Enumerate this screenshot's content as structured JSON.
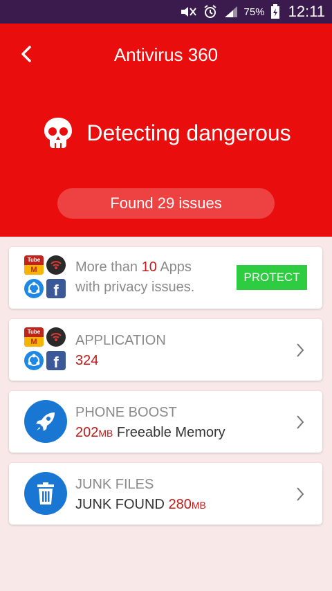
{
  "status_bar": {
    "battery": "75%",
    "time": "12:11"
  },
  "header": {
    "title": "Antivirus 360",
    "danger_text": "Detecting dangerous",
    "issues_label": "Found 29 issues",
    "bg_color": "#ea0d0d"
  },
  "privacy_card": {
    "prefix": "More than ",
    "count": "10",
    "suffix": " Apps",
    "line2": "with privacy issues.",
    "button_label": "PROTECT"
  },
  "application_card": {
    "title": "APPLICATION",
    "count": "324"
  },
  "boost_card": {
    "title": "PHONE BOOST",
    "value": "202",
    "unit": "MB",
    "desc": " Freeable Memory"
  },
  "junk_card": {
    "title": "JUNK FILES",
    "prefix": "JUNK FOUND ",
    "value": "280",
    "unit": "MB"
  },
  "icons": {
    "app_icons": [
      "tubemate-app-icon",
      "wifi-app-icon",
      "shareit-app-icon",
      "facebook-app-icon"
    ],
    "fb_letter": "f",
    "tube_top": "Tube",
    "tube_bottom": "M"
  }
}
